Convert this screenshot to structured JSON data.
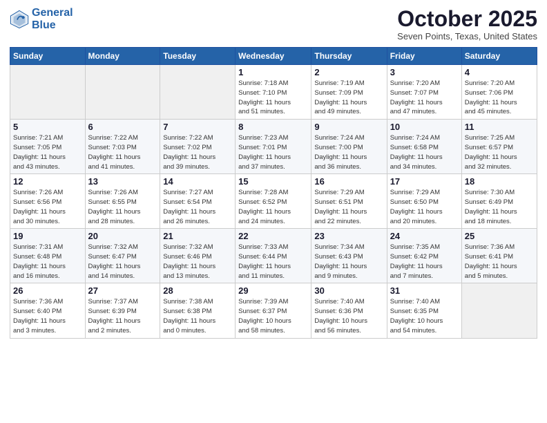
{
  "header": {
    "logo_line1": "General",
    "logo_line2": "Blue",
    "month": "October 2025",
    "location": "Seven Points, Texas, United States"
  },
  "days_of_week": [
    "Sunday",
    "Monday",
    "Tuesday",
    "Wednesday",
    "Thursday",
    "Friday",
    "Saturday"
  ],
  "weeks": [
    [
      {
        "day": "",
        "info": ""
      },
      {
        "day": "",
        "info": ""
      },
      {
        "day": "",
        "info": ""
      },
      {
        "day": "1",
        "info": "Sunrise: 7:18 AM\nSunset: 7:10 PM\nDaylight: 11 hours\nand 51 minutes."
      },
      {
        "day": "2",
        "info": "Sunrise: 7:19 AM\nSunset: 7:09 PM\nDaylight: 11 hours\nand 49 minutes."
      },
      {
        "day": "3",
        "info": "Sunrise: 7:20 AM\nSunset: 7:07 PM\nDaylight: 11 hours\nand 47 minutes."
      },
      {
        "day": "4",
        "info": "Sunrise: 7:20 AM\nSunset: 7:06 PM\nDaylight: 11 hours\nand 45 minutes."
      }
    ],
    [
      {
        "day": "5",
        "info": "Sunrise: 7:21 AM\nSunset: 7:05 PM\nDaylight: 11 hours\nand 43 minutes."
      },
      {
        "day": "6",
        "info": "Sunrise: 7:22 AM\nSunset: 7:03 PM\nDaylight: 11 hours\nand 41 minutes."
      },
      {
        "day": "7",
        "info": "Sunrise: 7:22 AM\nSunset: 7:02 PM\nDaylight: 11 hours\nand 39 minutes."
      },
      {
        "day": "8",
        "info": "Sunrise: 7:23 AM\nSunset: 7:01 PM\nDaylight: 11 hours\nand 37 minutes."
      },
      {
        "day": "9",
        "info": "Sunrise: 7:24 AM\nSunset: 7:00 PM\nDaylight: 11 hours\nand 36 minutes."
      },
      {
        "day": "10",
        "info": "Sunrise: 7:24 AM\nSunset: 6:58 PM\nDaylight: 11 hours\nand 34 minutes."
      },
      {
        "day": "11",
        "info": "Sunrise: 7:25 AM\nSunset: 6:57 PM\nDaylight: 11 hours\nand 32 minutes."
      }
    ],
    [
      {
        "day": "12",
        "info": "Sunrise: 7:26 AM\nSunset: 6:56 PM\nDaylight: 11 hours\nand 30 minutes."
      },
      {
        "day": "13",
        "info": "Sunrise: 7:26 AM\nSunset: 6:55 PM\nDaylight: 11 hours\nand 28 minutes."
      },
      {
        "day": "14",
        "info": "Sunrise: 7:27 AM\nSunset: 6:54 PM\nDaylight: 11 hours\nand 26 minutes."
      },
      {
        "day": "15",
        "info": "Sunrise: 7:28 AM\nSunset: 6:52 PM\nDaylight: 11 hours\nand 24 minutes."
      },
      {
        "day": "16",
        "info": "Sunrise: 7:29 AM\nSunset: 6:51 PM\nDaylight: 11 hours\nand 22 minutes."
      },
      {
        "day": "17",
        "info": "Sunrise: 7:29 AM\nSunset: 6:50 PM\nDaylight: 11 hours\nand 20 minutes."
      },
      {
        "day": "18",
        "info": "Sunrise: 7:30 AM\nSunset: 6:49 PM\nDaylight: 11 hours\nand 18 minutes."
      }
    ],
    [
      {
        "day": "19",
        "info": "Sunrise: 7:31 AM\nSunset: 6:48 PM\nDaylight: 11 hours\nand 16 minutes."
      },
      {
        "day": "20",
        "info": "Sunrise: 7:32 AM\nSunset: 6:47 PM\nDaylight: 11 hours\nand 14 minutes."
      },
      {
        "day": "21",
        "info": "Sunrise: 7:32 AM\nSunset: 6:46 PM\nDaylight: 11 hours\nand 13 minutes."
      },
      {
        "day": "22",
        "info": "Sunrise: 7:33 AM\nSunset: 6:44 PM\nDaylight: 11 hours\nand 11 minutes."
      },
      {
        "day": "23",
        "info": "Sunrise: 7:34 AM\nSunset: 6:43 PM\nDaylight: 11 hours\nand 9 minutes."
      },
      {
        "day": "24",
        "info": "Sunrise: 7:35 AM\nSunset: 6:42 PM\nDaylight: 11 hours\nand 7 minutes."
      },
      {
        "day": "25",
        "info": "Sunrise: 7:36 AM\nSunset: 6:41 PM\nDaylight: 11 hours\nand 5 minutes."
      }
    ],
    [
      {
        "day": "26",
        "info": "Sunrise: 7:36 AM\nSunset: 6:40 PM\nDaylight: 11 hours\nand 3 minutes."
      },
      {
        "day": "27",
        "info": "Sunrise: 7:37 AM\nSunset: 6:39 PM\nDaylight: 11 hours\nand 2 minutes."
      },
      {
        "day": "28",
        "info": "Sunrise: 7:38 AM\nSunset: 6:38 PM\nDaylight: 11 hours\nand 0 minutes."
      },
      {
        "day": "29",
        "info": "Sunrise: 7:39 AM\nSunset: 6:37 PM\nDaylight: 10 hours\nand 58 minutes."
      },
      {
        "day": "30",
        "info": "Sunrise: 7:40 AM\nSunset: 6:36 PM\nDaylight: 10 hours\nand 56 minutes."
      },
      {
        "day": "31",
        "info": "Sunrise: 7:40 AM\nSunset: 6:35 PM\nDaylight: 10 hours\nand 54 minutes."
      },
      {
        "day": "",
        "info": ""
      }
    ]
  ]
}
